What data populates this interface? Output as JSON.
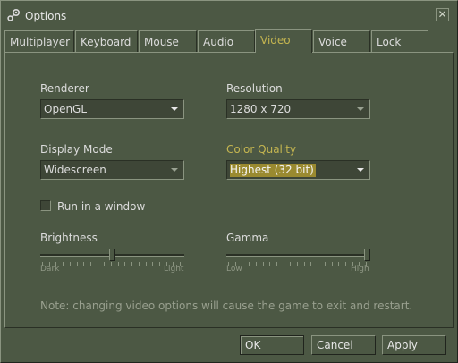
{
  "window": {
    "title": "Options",
    "close_glyph": "✕"
  },
  "tabs": [
    {
      "label": "Multiplayer",
      "active": false
    },
    {
      "label": "Keyboard",
      "active": false
    },
    {
      "label": "Mouse",
      "active": false
    },
    {
      "label": "Audio",
      "active": false
    },
    {
      "label": "Video",
      "active": true
    },
    {
      "label": "Voice",
      "active": false
    },
    {
      "label": "Lock",
      "active": false
    }
  ],
  "video": {
    "renderer": {
      "label": "Renderer",
      "value": "OpenGL"
    },
    "resolution": {
      "label": "Resolution",
      "value": "1280 x 720"
    },
    "display_mode": {
      "label": "Display Mode",
      "value": "Widescreen"
    },
    "color_quality": {
      "label": "Color Quality",
      "value": "Highest (32 bit)"
    },
    "run_in_window": {
      "label": "Run in a window",
      "checked": false
    },
    "brightness": {
      "label": "Brightness",
      "min_label": "Dark",
      "max_label": "Light",
      "level": 0.5
    },
    "gamma": {
      "label": "Gamma",
      "min_label": "Low",
      "max_label": "High",
      "level": 1.0
    },
    "note": "Note: changing video options will cause the game to exit and restart."
  },
  "buttons": {
    "ok": "OK",
    "cancel": "Cancel",
    "apply": "Apply"
  },
  "colors": {
    "background": "#4c5844",
    "highlight": "#c4b550",
    "selection": "#9a8a30"
  },
  "icons": {
    "app": "steam-icon",
    "close": "close-icon",
    "dropdown": "chevron-down-icon"
  }
}
